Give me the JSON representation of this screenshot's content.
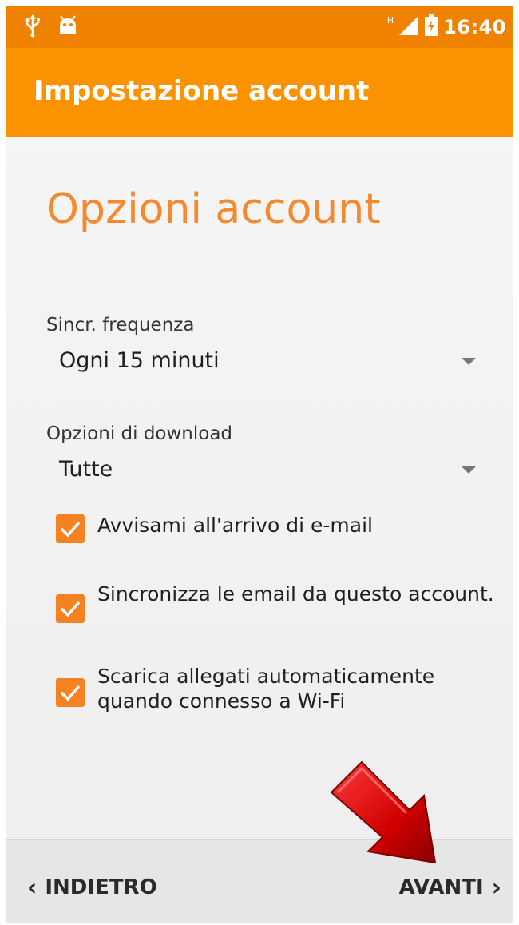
{
  "status_bar": {
    "icons_left": [
      "usb-icon",
      "android-debug-icon"
    ],
    "network_type": "H",
    "time": "16:40",
    "accent_color": "#f08200"
  },
  "app_bar": {
    "title": "Impostazione account",
    "color": "#fb9300"
  },
  "page": {
    "heading": "Opzioni account",
    "heading_color": "#f48a30"
  },
  "sync_frequency": {
    "label": "Sincr. frequenza",
    "selected": "Ogni 15 minuti"
  },
  "download_options": {
    "label": "Opzioni di download",
    "selected": "Tutte"
  },
  "checkboxes": [
    {
      "label": "Avvisami all'arrivo di e-mail",
      "checked": true
    },
    {
      "label": "Sincronizza le email da questo account.",
      "checked": true
    },
    {
      "label": "Scarica allegati automaticamente quando connesso a Wi-Fi",
      "checked": true
    }
  ],
  "nav": {
    "back_label": "INDIETRO",
    "next_label": "AVANTI",
    "back_icon": "chevron-left-icon",
    "next_icon": "chevron-right-icon"
  },
  "overlay": {
    "annotation_icon": "red-arrow-icon",
    "color": "#d40000"
  }
}
